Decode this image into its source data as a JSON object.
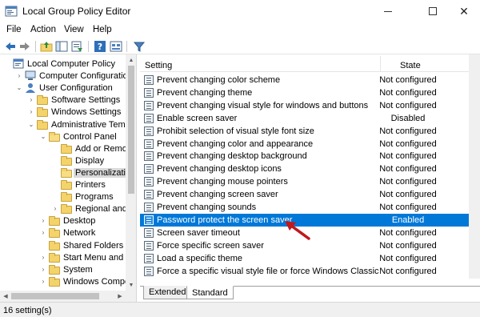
{
  "window": {
    "title": "Local Group Policy Editor",
    "minimize_glyph": "",
    "maximize_glyph": "",
    "close_glyph": "✕"
  },
  "menu": [
    "File",
    "Action",
    "View",
    "Help"
  ],
  "toolbar": {
    "buttons": [
      "back-icon",
      "forward-icon",
      "up-folder-icon",
      "show-hide-tree-icon",
      "export-list-icon",
      "help-icon",
      "properties-icon",
      "filter-icon"
    ]
  },
  "tree": {
    "items": [
      {
        "label": "Local Computer Policy",
        "indent": 0,
        "expander": "",
        "icon": "computer-policy-icon"
      },
      {
        "label": "Computer Configuration",
        "indent": 1,
        "expander": "›",
        "icon": "computer-icon"
      },
      {
        "label": "User Configuration",
        "indent": 1,
        "expander": "⌄",
        "icon": "user-icon"
      },
      {
        "label": "Software Settings",
        "indent": 2,
        "expander": "›",
        "icon": "folder-icon"
      },
      {
        "label": "Windows Settings",
        "indent": 2,
        "expander": "›",
        "icon": "folder-icon"
      },
      {
        "label": "Administrative Templat",
        "indent": 2,
        "expander": "⌄",
        "icon": "folder-icon"
      },
      {
        "label": "Control Panel",
        "indent": 3,
        "expander": "⌄",
        "icon": "folder-open-icon"
      },
      {
        "label": "Add or Remove",
        "indent": 4,
        "expander": "",
        "icon": "folder-icon"
      },
      {
        "label": "Display",
        "indent": 4,
        "expander": "",
        "icon": "folder-icon"
      },
      {
        "label": "Personalization",
        "indent": 4,
        "expander": "",
        "icon": "folder-open-icon",
        "selected": true
      },
      {
        "label": "Printers",
        "indent": 4,
        "expander": "",
        "icon": "folder-icon"
      },
      {
        "label": "Programs",
        "indent": 4,
        "expander": "",
        "icon": "folder-icon"
      },
      {
        "label": "Regional and La",
        "indent": 4,
        "expander": "›",
        "icon": "folder-icon"
      },
      {
        "label": "Desktop",
        "indent": 3,
        "expander": "›",
        "icon": "folder-icon"
      },
      {
        "label": "Network",
        "indent": 3,
        "expander": "›",
        "icon": "folder-icon"
      },
      {
        "label": "Shared Folders",
        "indent": 3,
        "expander": "",
        "icon": "folder-icon"
      },
      {
        "label": "Start Menu and Tasl",
        "indent": 3,
        "expander": "›",
        "icon": "folder-icon"
      },
      {
        "label": "System",
        "indent": 3,
        "expander": "›",
        "icon": "folder-icon"
      },
      {
        "label": "Windows Compone",
        "indent": 3,
        "expander": "›",
        "icon": "folder-icon"
      }
    ]
  },
  "list": {
    "headers": {
      "setting": "Setting",
      "state": "State"
    },
    "rows": [
      {
        "name": "Prevent changing color scheme",
        "state": "Not configured"
      },
      {
        "name": "Prevent changing theme",
        "state": "Not configured"
      },
      {
        "name": "Prevent changing visual style for windows and buttons",
        "state": "Not configured"
      },
      {
        "name": "Enable screen saver",
        "state": "Disabled"
      },
      {
        "name": "Prohibit selection of visual style font size",
        "state": "Not configured"
      },
      {
        "name": "Prevent changing color and appearance",
        "state": "Not configured"
      },
      {
        "name": "Prevent changing desktop background",
        "state": "Not configured"
      },
      {
        "name": "Prevent changing desktop icons",
        "state": "Not configured"
      },
      {
        "name": "Prevent changing mouse pointers",
        "state": "Not configured"
      },
      {
        "name": "Prevent changing screen saver",
        "state": "Not configured"
      },
      {
        "name": "Prevent changing sounds",
        "state": "Not configured"
      },
      {
        "name": "Password protect the screen saver",
        "state": "Enabled",
        "highlighted": true
      },
      {
        "name": "Screen saver timeout",
        "state": "Not configured"
      },
      {
        "name": "Force specific screen saver",
        "state": "Not configured"
      },
      {
        "name": "Load a specific theme",
        "state": "Not configured"
      },
      {
        "name": "Force a specific visual style file or force Windows Classic",
        "state": "Not configured"
      }
    ]
  },
  "tabs": [
    "Extended",
    "Standard"
  ],
  "status": {
    "text": "16 setting(s)"
  },
  "colors": {
    "highlight": "#0078d7",
    "annotation_arrow": "#c0181e"
  }
}
